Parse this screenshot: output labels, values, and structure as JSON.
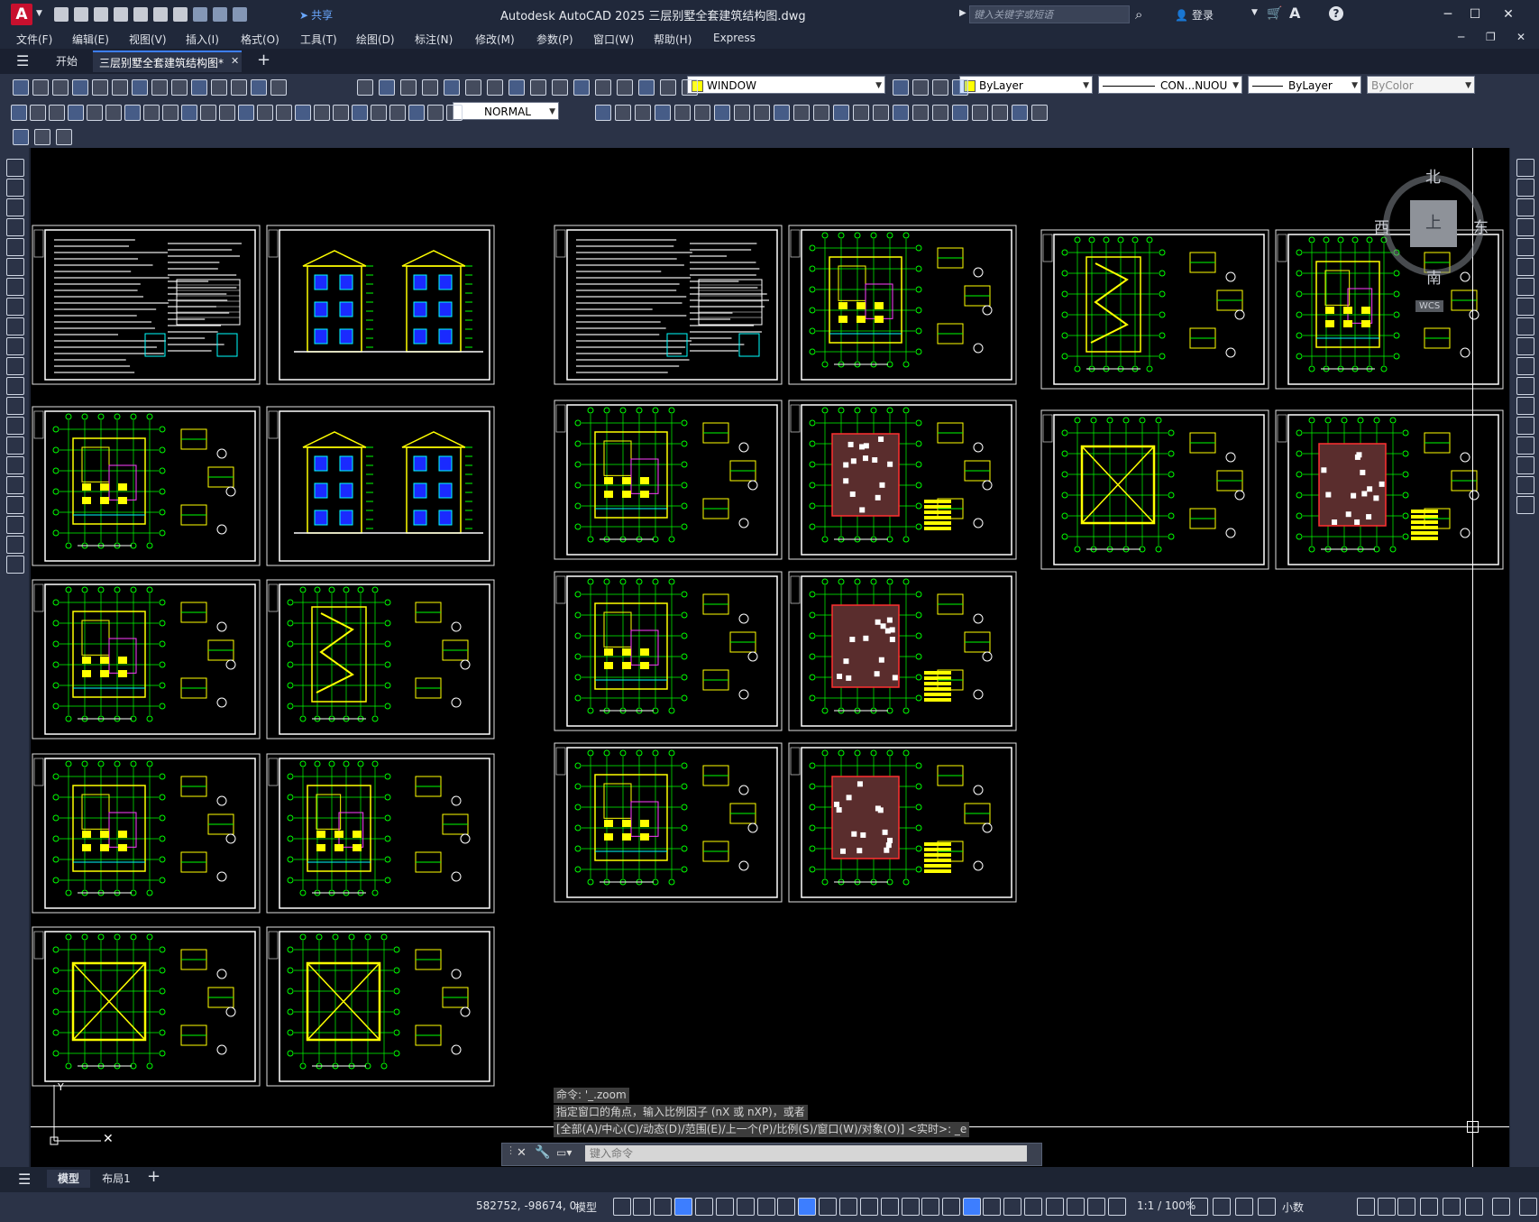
{
  "app": {
    "logo": "A",
    "title": "Autodesk AutoCAD 2025    三层别墅全套建筑结构图.dwg",
    "share_label": "共享",
    "login_label": "登录"
  },
  "search": {
    "placeholder": "键入关键字或短语"
  },
  "window_controls": {
    "minimize": "─",
    "maximize": "☐",
    "close": "✕"
  },
  "menu": [
    "文件(F)",
    "编辑(E)",
    "视图(V)",
    "插入(I)",
    "格式(O)",
    "工具(T)",
    "绘图(D)",
    "标注(N)",
    "修改(M)",
    "参数(P)",
    "窗口(W)",
    "帮助(H)",
    "Express"
  ],
  "tabs": {
    "start": "开始",
    "document": "三层别墅全套建筑结构图*",
    "close": "✕",
    "add": "+"
  },
  "toolbar": {
    "window_combo": "WINDOW",
    "layer_color": "ByLayer",
    "linetype": "CON...NUOU",
    "lineweight": "ByLayer",
    "plotstyle": "ByColor",
    "dimstyle": "NORMAL"
  },
  "compass": {
    "north": "北",
    "south": "南",
    "east": "东",
    "west": "西",
    "top": "上",
    "wcs": "WCS"
  },
  "command": {
    "history": [
      "命令: '_.zoom",
      "指定窗口的角点，输入比例因子 (nX 或 nXP)，或者",
      "[全部(A)/中心(C)/动态(D)/范围(E)/上一个(P)/比例(S)/窗口(W)/对象(O)] <实时>: _e"
    ],
    "placeholder": "键入命令"
  },
  "layout_tabs": {
    "model": "模型",
    "layout1": "布局1",
    "add": "+"
  },
  "status": {
    "coords": "582752, -98674, 0",
    "model": "模型",
    "scale": "1:1 / 100%",
    "units": "小数"
  },
  "colors": {
    "accent": "#3d7eff",
    "canvas": "#000000",
    "ui_dark": "#2b3347",
    "plan_yellow": "#ffff00",
    "plan_green": "#00ff00",
    "plan_cyan": "#00ffff",
    "plan_red": "#ff0000"
  }
}
